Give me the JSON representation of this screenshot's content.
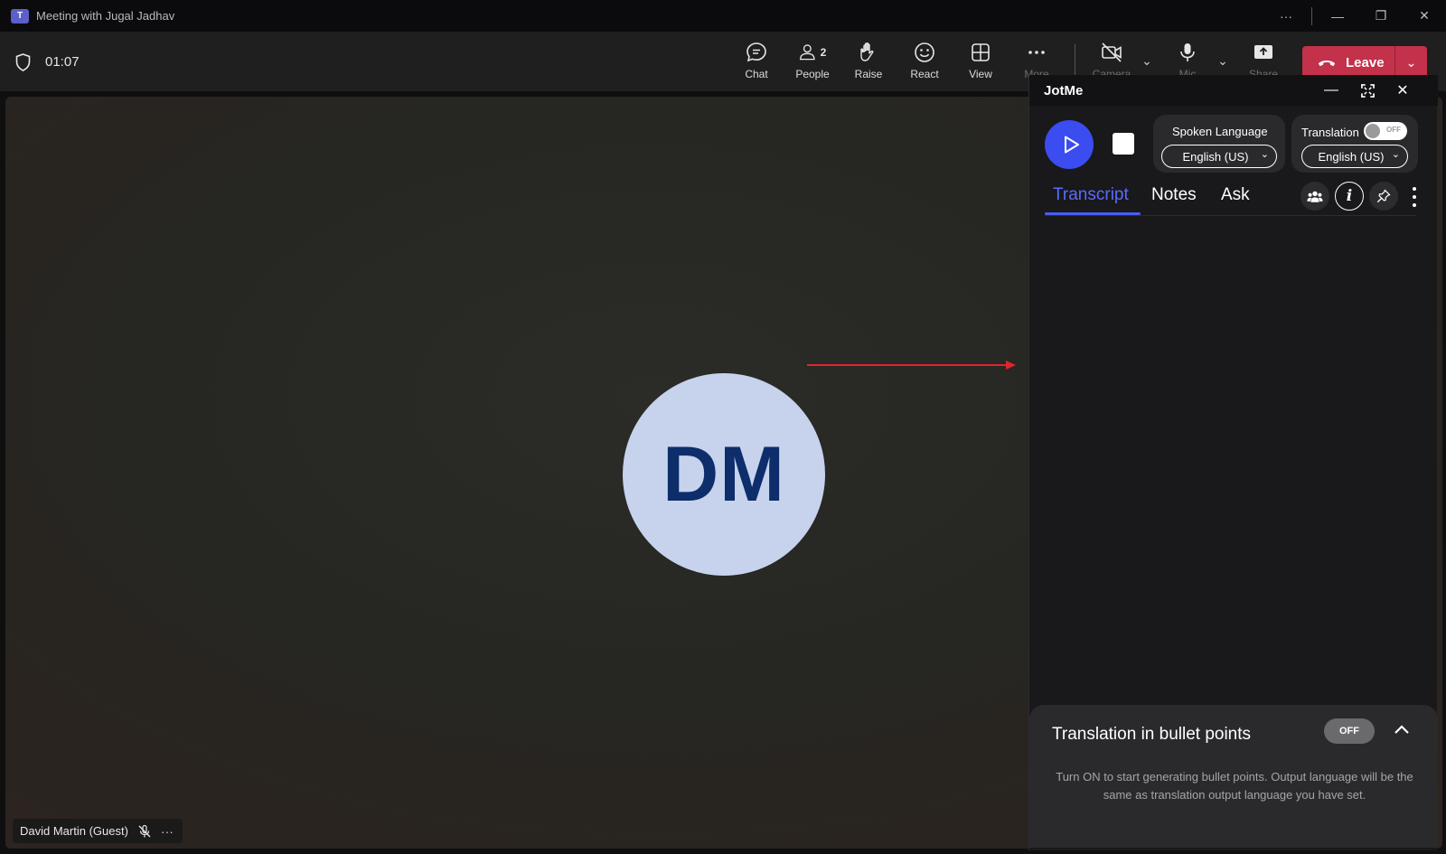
{
  "window": {
    "title": "Meeting with Jugal Jadhav"
  },
  "meeting": {
    "timer": "01:07"
  },
  "toolbar": {
    "chat": "Chat",
    "people": "People",
    "people_count": "2",
    "raise": "Raise",
    "react": "React",
    "view": "View",
    "more": "More",
    "camera": "Camera",
    "mic": "Mic",
    "share": "Share",
    "leave": "Leave"
  },
  "stage": {
    "avatar_initials": "DM",
    "participant_name": "David Martin (Guest)"
  },
  "jotme": {
    "title": "JotMe",
    "spoken_language_label": "Spoken Language",
    "spoken_language_value": "English (US)",
    "translation_label": "Translation",
    "translation_toggle": "OFF",
    "translation_value": "English (US)",
    "tabs": {
      "transcript": "Transcript",
      "notes": "Notes",
      "ask": "Ask"
    },
    "bullet": {
      "title": "Translation in bullet points",
      "toggle": "OFF",
      "description": "Turn ON to start generating bullet points. Output language will be the same as translation output language you have set."
    }
  },
  "colors": {
    "accent": "#3b4cf0",
    "leave": "#c4314b",
    "arrow": "#e0262b"
  }
}
